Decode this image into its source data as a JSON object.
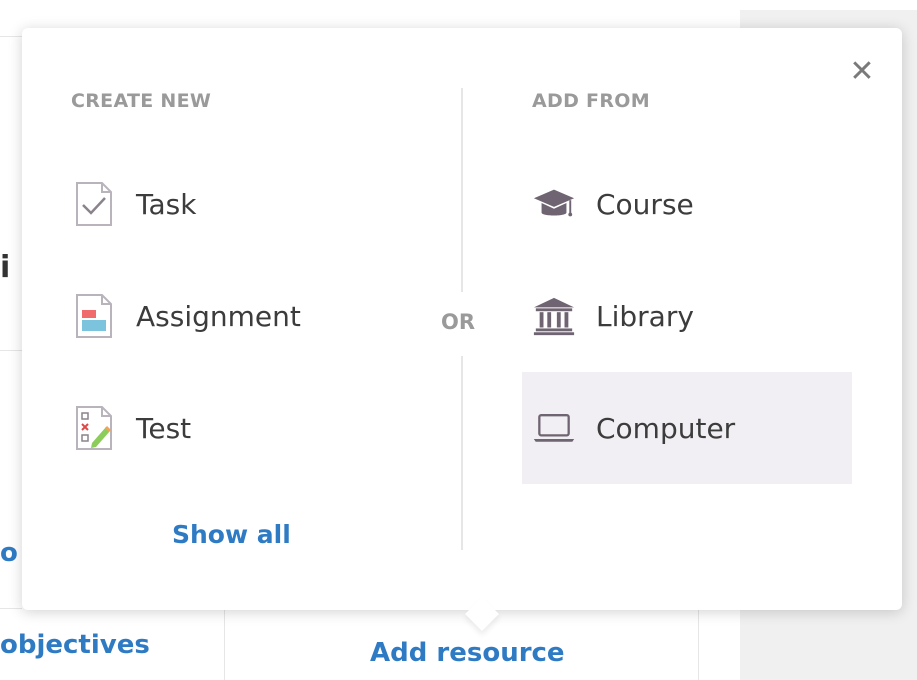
{
  "background": {
    "fragment_top": "i",
    "fragment_mid": "o",
    "objectives_link": "objectives",
    "add_resource_link": "Add resource"
  },
  "popup": {
    "close_symbol": "✕",
    "create_new": {
      "label": "CREATE NEW",
      "items": [
        {
          "label": "Task",
          "icon": "task-checkbox-icon"
        },
        {
          "label": "Assignment",
          "icon": "assignment-doc-icon"
        },
        {
          "label": "Test",
          "icon": "test-checklist-icon"
        }
      ],
      "show_all": "Show all"
    },
    "or_label": "OR",
    "add_from": {
      "label": "ADD FROM",
      "items": [
        {
          "label": "Course",
          "icon": "graduation-cap-icon"
        },
        {
          "label": "Library",
          "icon": "library-building-icon"
        },
        {
          "label": "Computer",
          "icon": "laptop-icon",
          "highlighted": true
        }
      ]
    }
  },
  "colors": {
    "link": "#2e7bc4",
    "muted_label": "#9a9a9a",
    "icon": "#6f6471",
    "highlight": "#f1eff4",
    "assignment_red": "#f06b6b",
    "assignment_blue": "#7cc4de"
  }
}
